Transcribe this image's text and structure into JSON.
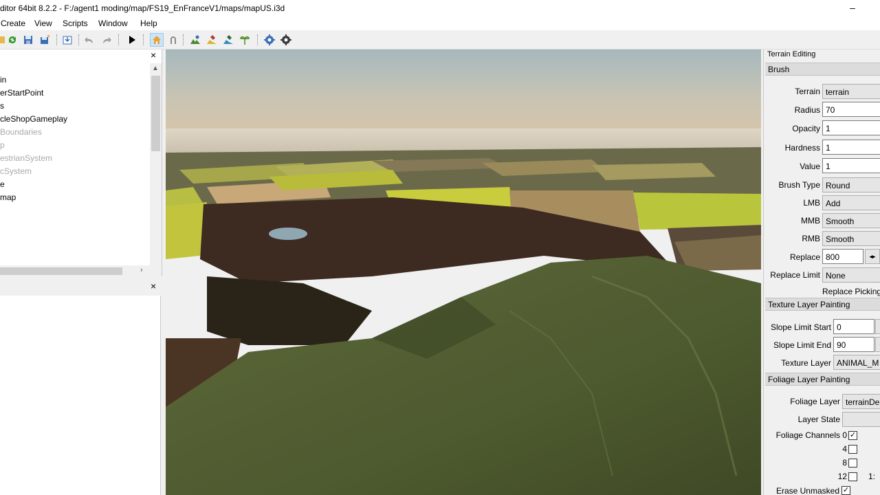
{
  "window": {
    "title": "ditor 64bit 8.2.2 - F:/agent1 moding/map/FS19_EnFranceV1/maps/mapUS.i3d",
    "minimize": "–"
  },
  "menu": [
    "Create",
    "View",
    "Scripts",
    "Window",
    "Help"
  ],
  "scenegraph": {
    "close": "×",
    "nodes": [
      {
        "label": "in",
        "dim": false
      },
      {
        "label": "erStartPoint",
        "dim": false
      },
      {
        "label": "s",
        "dim": false
      },
      {
        "label": "cleShopGameplay",
        "dim": false
      },
      {
        "label": "Boundaries",
        "dim": true
      },
      {
        "label": "p",
        "dim": true
      },
      {
        "label": "estrianSystem",
        "dim": true
      },
      {
        "label": "cSystem",
        "dim": true
      },
      {
        "label": "e",
        "dim": false
      },
      {
        "label": "map",
        "dim": false
      }
    ]
  },
  "attributes": {
    "close": "×"
  },
  "terrain": {
    "title": "Terrain Editing",
    "brush": {
      "header": "Brush",
      "terrain_label": "Terrain",
      "terrain_value": "terrain",
      "radius_label": "Radius",
      "radius_value": "70",
      "opacity_label": "Opacity",
      "opacity_value": "1",
      "hardness_label": "Hardness",
      "hardness_value": "1",
      "value_label": "Value",
      "value_value": "1",
      "brushtype_label": "Brush Type",
      "brushtype_value": "Round",
      "lmb_label": "LMB",
      "lmb_value": "Add",
      "mmb_label": "MMB",
      "mmb_value": "Smooth",
      "rmb_label": "RMB",
      "rmb_value": "Smooth",
      "replace_label": "Replace",
      "replace_value": "800",
      "replacelimit_label": "Replace Limit",
      "replacelimit_value": "None",
      "replacepicking": "Replace Picking"
    },
    "texture": {
      "header": "Texture Layer Painting",
      "slope_start_label": "Slope Limit Start",
      "slope_start_value": "0",
      "slope_end_label": "Slope Limit End",
      "slope_end_value": "90",
      "layer_label": "Texture Layer",
      "layer_value": "ANIMAL_M"
    },
    "foliage": {
      "header": "Foliage Layer Painting",
      "layer_label": "Foliage Layer",
      "layer_value": "terrainDe",
      "state_label": "Layer State",
      "state_value": "",
      "channels_label": "Foliage Channels",
      "channels": [
        {
          "num": "0",
          "checked": true
        },
        {
          "num": "4",
          "checked": false
        },
        {
          "num": "8",
          "checked": false
        },
        {
          "num": "12",
          "checked": false
        }
      ],
      "channel_extra": "1:",
      "erase_label": "Erase Unmasked",
      "erase_checked": true
    }
  },
  "colors": {
    "accent_active": "#cce4f7",
    "panel_bg": "#f0f0f0"
  }
}
